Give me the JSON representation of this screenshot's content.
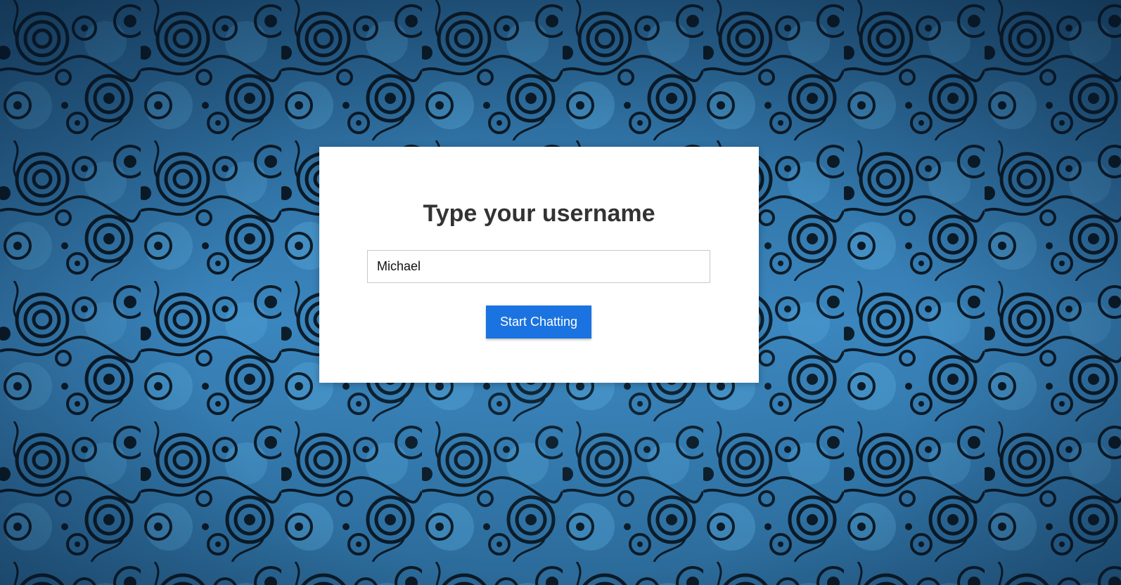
{
  "login": {
    "title": "Type your username",
    "username_value": "Michael",
    "submit_label": "Start Chatting"
  },
  "theme": {
    "accent": "#1a73e0",
    "background_blue": "#2f6e9c",
    "pattern_dark": "#0b1a26",
    "pattern_light": "#4a9fd4"
  }
}
